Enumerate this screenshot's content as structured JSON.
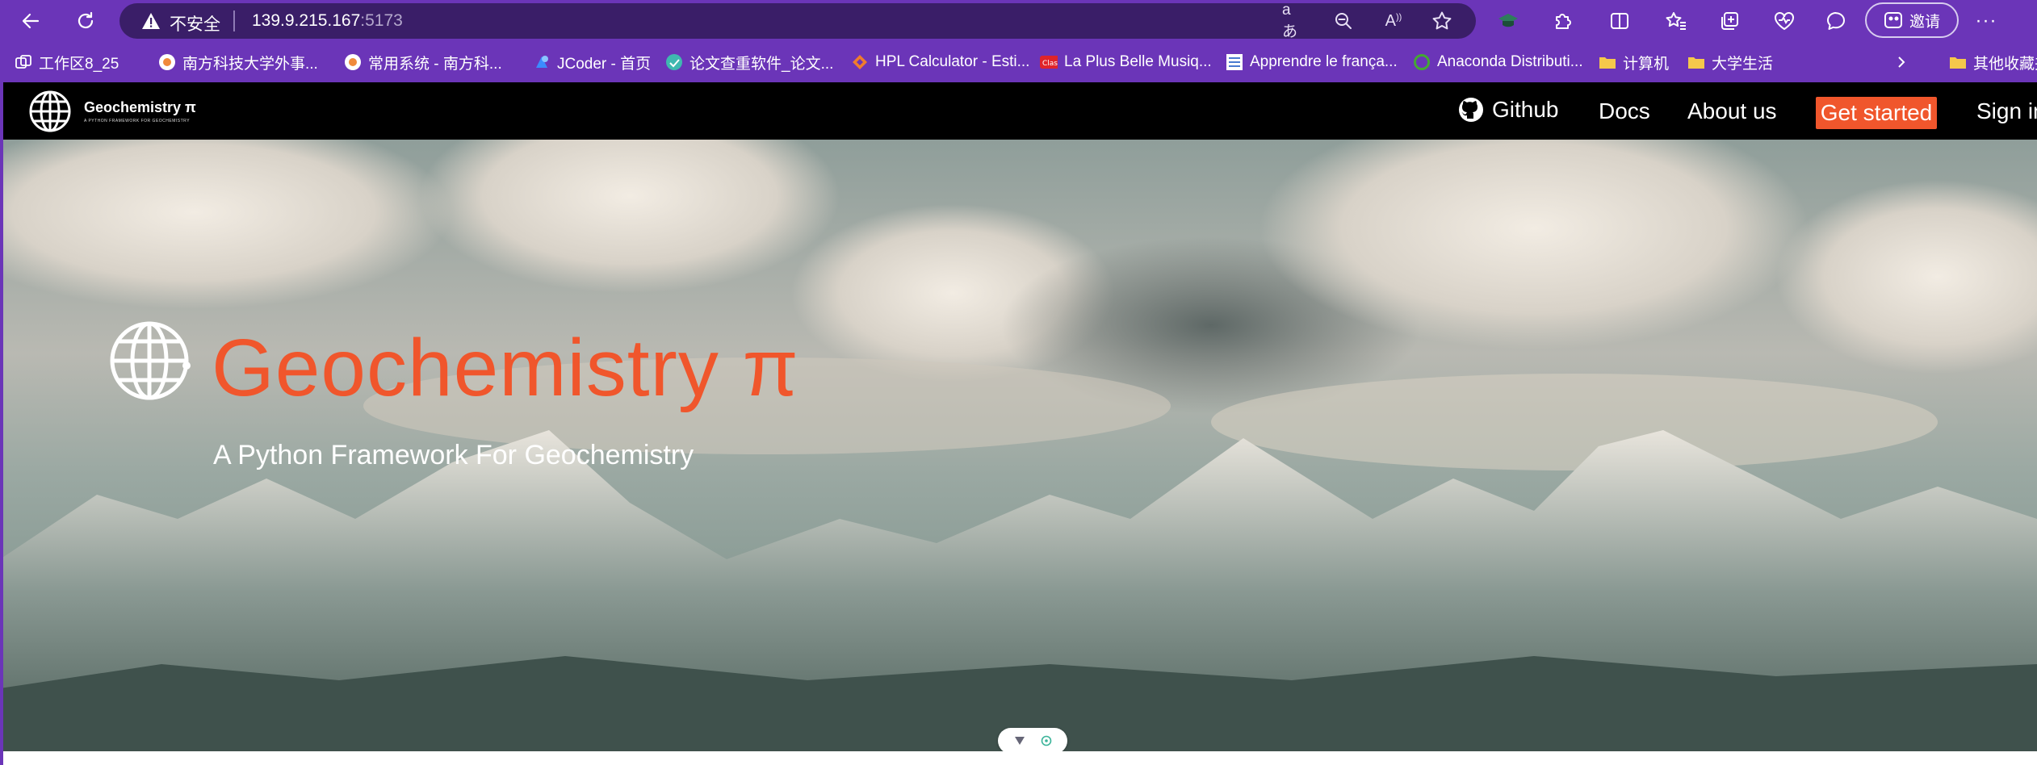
{
  "browser": {
    "insecure_label": "不安全",
    "url_host": "139.9.215.167",
    "url_port": ":5173",
    "invite_label": "邀请",
    "icons": [
      "back-icon",
      "refresh-icon",
      "warning-icon",
      "read-aloud-text-icon",
      "zoom-out-icon",
      "read-aloud-icon",
      "favorite-star-icon",
      "extension-icon",
      "puzzle-icon",
      "split-screen-icon",
      "favorites-icon",
      "collections-icon",
      "performance-icon",
      "chat-icon",
      "more-icon"
    ]
  },
  "bookmarks": [
    {
      "label": "工作区8_25",
      "icon": "workspaces-icon"
    },
    {
      "label": "南方科技大学外事...",
      "icon": "sustech-favicon-icon"
    },
    {
      "label": "常用系统 - 南方科...",
      "icon": "sustech-favicon-icon"
    },
    {
      "label": "JCoder - 首页",
      "icon": "jcoder-favicon-icon"
    },
    {
      "label": "论文查重软件_论文...",
      "icon": "paper-check-favicon-icon"
    },
    {
      "label": "HPL Calculator - Esti...",
      "icon": "hpl-favicon-icon"
    },
    {
      "label": "La Plus Belle Musiq...",
      "icon": "music-favicon-icon"
    },
    {
      "label": "Apprendre le frança...",
      "icon": "french-favicon-icon"
    },
    {
      "label": "Anaconda Distributi...",
      "icon": "anaconda-favicon-icon"
    },
    {
      "label": "计算机",
      "icon": "folder-icon"
    },
    {
      "label": "大学生活",
      "icon": "folder-icon"
    },
    {
      "label": "其他收藏夹",
      "icon": "folder-icon"
    }
  ],
  "site": {
    "logo_title": "Geochemistry π",
    "logo_tagline": "A PYTHON FRAMEWORK FOR GEOCHEMISTRY",
    "nav": {
      "github": "Github",
      "docs": "Docs",
      "about": "About us",
      "get_started": "Get started",
      "sign_in": "Sign in"
    },
    "hero": {
      "title": "Geochemistry π",
      "subtitle": "A Python Framework For Geochemistry"
    },
    "colors": {
      "accent": "#f0562c",
      "header_bg": "#000000",
      "browser_frame": "#6b35b8"
    }
  }
}
